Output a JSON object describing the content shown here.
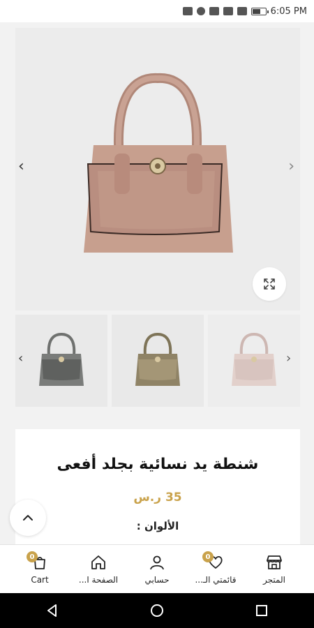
{
  "status_bar": {
    "time": "6:05 PM"
  },
  "gallery": {
    "main_image_alt": "pink snake leather handbag",
    "thumbnails": [
      {
        "name": "grey-bag-thumbnail"
      },
      {
        "name": "olive-bag-thumbnail"
      },
      {
        "name": "pink-bag-thumbnail"
      }
    ]
  },
  "product": {
    "title": "شنطة يد نسائية بجلد أفعى",
    "price": "35 ر.س",
    "colors_label": "الألوان :"
  },
  "bottom_nav": {
    "items": [
      {
        "label": "Cart",
        "badge": "0",
        "icon": "cart-icon"
      },
      {
        "label": "الصفحة ا...",
        "icon": "home-icon"
      },
      {
        "label": "حسابي",
        "icon": "user-icon"
      },
      {
        "label": "قائمتي الـ...",
        "badge": "0",
        "icon": "heart-icon"
      },
      {
        "label": "المتجر",
        "icon": "store-icon"
      }
    ]
  },
  "colors": {
    "accent": "#c9a24b",
    "bag_pink": "#c9a293",
    "bag_grey": "#7a7c7a",
    "bag_olive": "#8f8366"
  }
}
